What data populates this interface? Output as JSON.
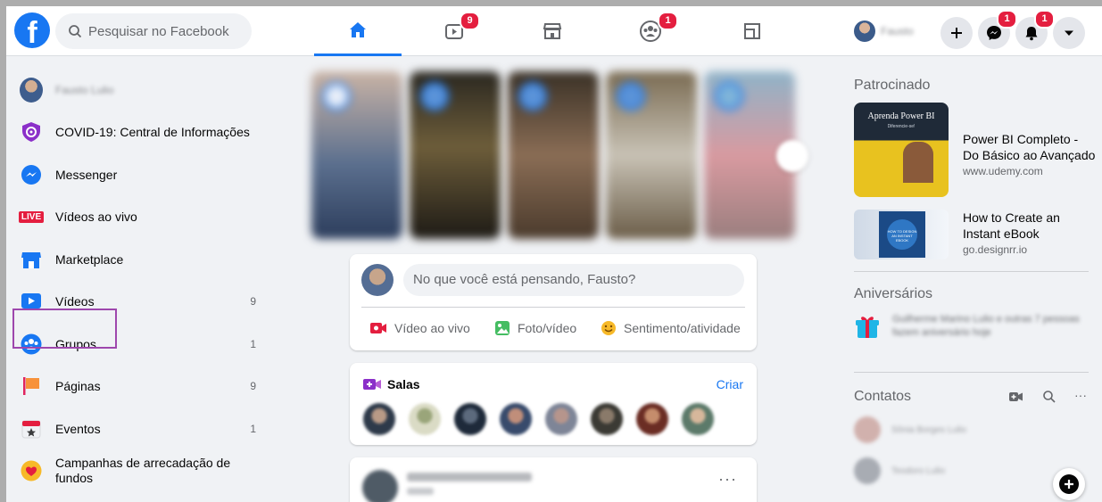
{
  "topbar": {
    "logo_letter": "f",
    "search_placeholder": "Pesquisar no Facebook",
    "tabs": [
      {
        "name": "home",
        "icon": "home-icon",
        "badge": ""
      },
      {
        "name": "watch",
        "icon": "video-icon",
        "badge": "9"
      },
      {
        "name": "marketplace",
        "icon": "store-icon",
        "badge": ""
      },
      {
        "name": "groups",
        "icon": "groups-icon",
        "badge": "1"
      },
      {
        "name": "gaming",
        "icon": "gaming-icon",
        "badge": ""
      }
    ],
    "profile_name": "Fausto",
    "messenger_badge": "1",
    "notifications_badge": "1"
  },
  "sidebar": {
    "items": [
      {
        "label": "Fausto Lulio",
        "count": "",
        "icon": "profile-avatar"
      },
      {
        "label": "COVID-19: Central de Informações",
        "count": "",
        "icon": "covid-shield-icon"
      },
      {
        "label": "Messenger",
        "count": "",
        "icon": "messenger-icon"
      },
      {
        "label": "Vídeos ao vivo",
        "count": "",
        "icon": "live-icon"
      },
      {
        "label": "Marketplace",
        "count": "",
        "icon": "marketplace-icon"
      },
      {
        "label": "Vídeos",
        "count": "9",
        "icon": "videos-icon"
      },
      {
        "label": "Grupos",
        "count": "1",
        "icon": "groups-icon"
      },
      {
        "label": "Páginas",
        "count": "9",
        "icon": "pages-flag-icon"
      },
      {
        "label": "Eventos",
        "count": "1",
        "icon": "events-icon"
      },
      {
        "label": "Campanhas de arrecadação de fundos",
        "count": "",
        "icon": "fundraiser-icon"
      }
    ],
    "live_badge": "LIVE"
  },
  "composer": {
    "placeholder": "No que você está pensando, Fausto?",
    "actions": [
      "Vídeo ao vivo",
      "Foto/vídeo",
      "Sentimento/atividade"
    ]
  },
  "rooms": {
    "title": "Salas",
    "create_label": "Criar"
  },
  "right": {
    "sponsored_title": "Patrocinado",
    "ads": [
      {
        "title": "Power BI Completo - Do Básico ao Avançado",
        "domain": "www.udemy.com",
        "image_text": "Aprenda Power BI",
        "image_subtext": "Diferencie-se!"
      },
      {
        "title": "How to Create an Instant eBook",
        "domain": "go.designrr.io",
        "image_text": "HOW TO DESIGN AN INSTANT EBOOK"
      }
    ],
    "birthdays_title": "Aniversários",
    "birthday_text": "Guilherme Marino Lulio e outras 7 pessoas fazem aniversário hoje",
    "contacts_title": "Contatos",
    "contacts": [
      "Sônia Borges Lulio",
      "Teodoro Lulio"
    ]
  },
  "colors": {
    "brand": "#1877f2",
    "badge": "#e41e3f",
    "highlight": "#9e47ad"
  }
}
